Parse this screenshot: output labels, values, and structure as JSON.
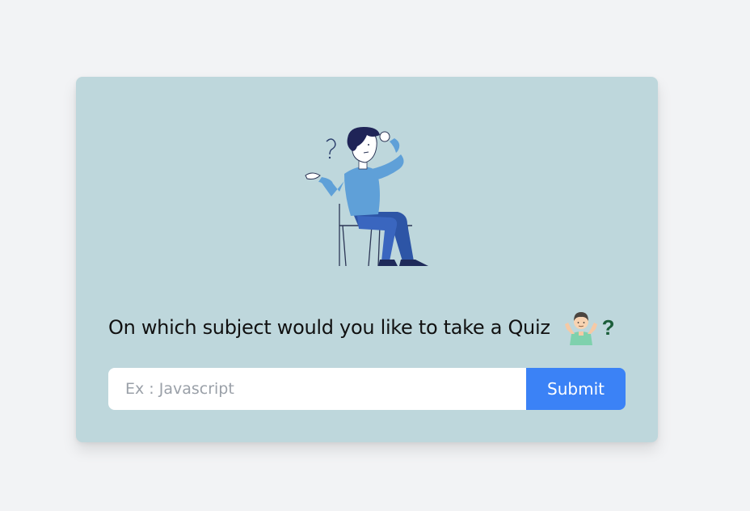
{
  "quiz": {
    "question": "On which subject would you like to take a Quiz",
    "question_mark": "?",
    "input_placeholder": "Ex : Javascript",
    "input_value": "",
    "submit_label": "Submit"
  },
  "icons": {
    "illustration": "thinking-person-on-chair-illustration",
    "emoji": "person-shrugging-icon"
  },
  "colors": {
    "page_background": "#f2f3f5",
    "card_background": "#bed7dc",
    "submit_button": "#3b82f6",
    "question_mark": "#1b5e3a"
  }
}
